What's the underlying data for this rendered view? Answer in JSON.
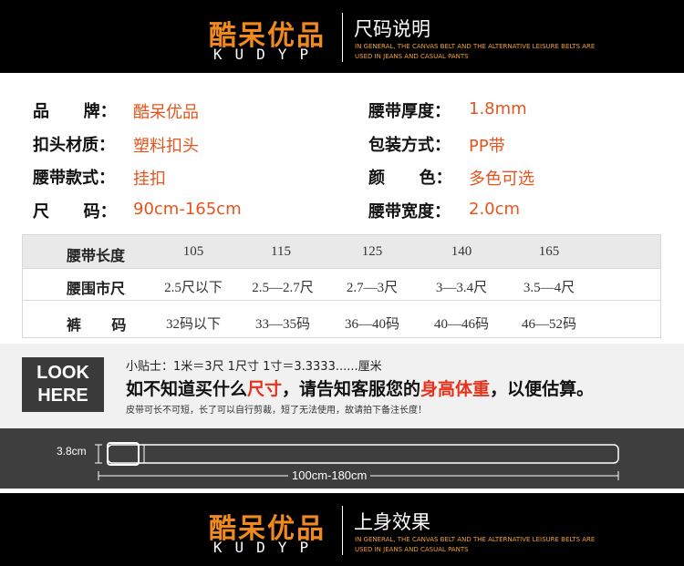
{
  "top_banner": {
    "brand_name": "酷呆优品",
    "brand_sub": "KUDYP",
    "section_title": "尺码说明",
    "sub_en_line1": "IN GENERAL, THE CANVAS BELT AND THE ALTERNATIVE LEISURE BELTS ARE",
    "sub_en_line2": "USED IN JEANS AND CASUAL PANTS"
  },
  "specs": [
    {
      "label": "品      牌：",
      "value": "酷呆优品"
    },
    {
      "label": "扣头材质：",
      "value": "塑料扣头"
    },
    {
      "label": "腰带款式：",
      "value": "挂扣"
    },
    {
      "label": "尺      码：",
      "value": "90cm-165cm"
    },
    {
      "label": "腰带厚度：",
      "value": "1.8mm"
    },
    {
      "label": "包装方式：",
      "value": "PP带"
    },
    {
      "label": "颜      色：",
      "value": "多色可选"
    },
    {
      "label": "腰带宽度：",
      "value": "2.0cm"
    }
  ],
  "size_table": {
    "rows": [
      {
        "label": "腰带长度",
        "cells": [
          "105",
          "115",
          "125",
          "140",
          "165"
        ]
      },
      {
        "label": "腰围市尺",
        "cells": [
          "2.5尺以下",
          "2.5—2.7尺",
          "2.7—3尺",
          "3—3.4尺",
          "3.5—4尺"
        ]
      },
      {
        "label": "裤      码",
        "cells": [
          "32码以下",
          "33—35码",
          "36—40码",
          "40—46码",
          "46—52码"
        ]
      }
    ]
  },
  "look": {
    "box_line1": "LOOK",
    "box_line2": "HERE",
    "tip": "小贴士：1米＝3尺    1尺寸   1寸＝3.3333......厘米",
    "headline_part1": "如不知道买什么",
    "headline_red1": "尺寸",
    "headline_part2": "，请告知客服您的",
    "headline_red2": "身高体重",
    "headline_part3": "，以便估算。",
    "note": "皮带可长不可短，长了可以自行剪裁，短了无法使用，故请拍下备注长度！"
  },
  "belt": {
    "width_label": "3.8cm",
    "length_label": "100cm-180cm"
  },
  "bottom_banner": {
    "brand_name": "酷呆优品",
    "brand_sub": "KUDYP",
    "section_title": "上身效果",
    "sub_en_line1": "IN GENERAL, THE CANVAS BELT AND THE ALTERNATIVE LEISURE BELTS ARE",
    "sub_en_line2": "USED IN JEANS AND CASUAL PANTS"
  },
  "colors": {
    "brand_orange": "#f08a1e",
    "value_red": "#e8531b",
    "headline_red": "#e8311b"
  }
}
